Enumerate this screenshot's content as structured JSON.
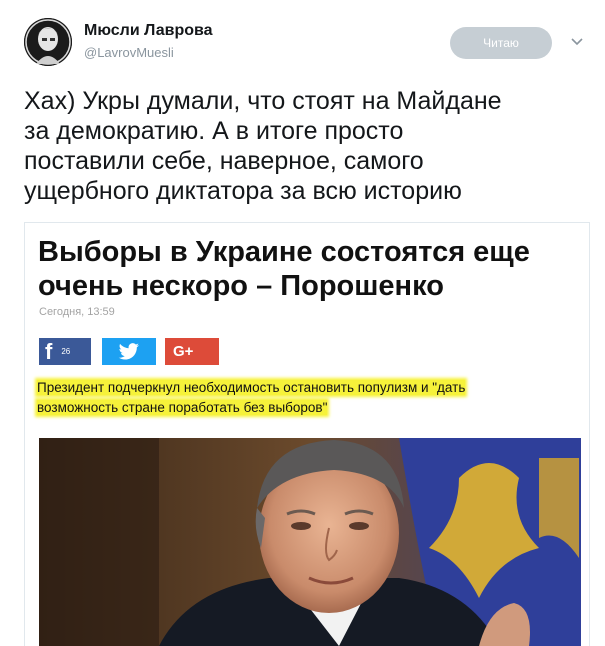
{
  "author": {
    "name": "Мюсли Лаврова",
    "handle": "@LavrovMuesli"
  },
  "follow_button_label": "Читаю",
  "tweet": {
    "lines": [
      "Хах) Укры думали, что стоят на Майдане",
      "за демократию. А в итоге просто",
      "поставили себе, наверное, самого",
      "ущербного диктатора за всю историю"
    ]
  },
  "article": {
    "headline_lines": [
      "Выборы в Украине состоятся еще",
      "очень нескоро – Порошенко"
    ],
    "date": "Сегодня, 13:59",
    "share": {
      "facebook_count": "26",
      "gplus_label": "G+"
    },
    "lead_lines": [
      "Президент подчеркнул необходимость остановить популизм и \"дать",
      "возможность стране поработать без выборов\""
    ]
  },
  "colors": {
    "facebook": "#3b5998",
    "twitter": "#1da1f2",
    "gplus": "#dd4b39",
    "highlight": "#f6f23a",
    "follow_button": "#c6ced4"
  },
  "icons": [
    "avatar-portrait",
    "chevron-down-icon",
    "facebook-icon",
    "twitter-bird-icon",
    "google-plus-icon"
  ]
}
